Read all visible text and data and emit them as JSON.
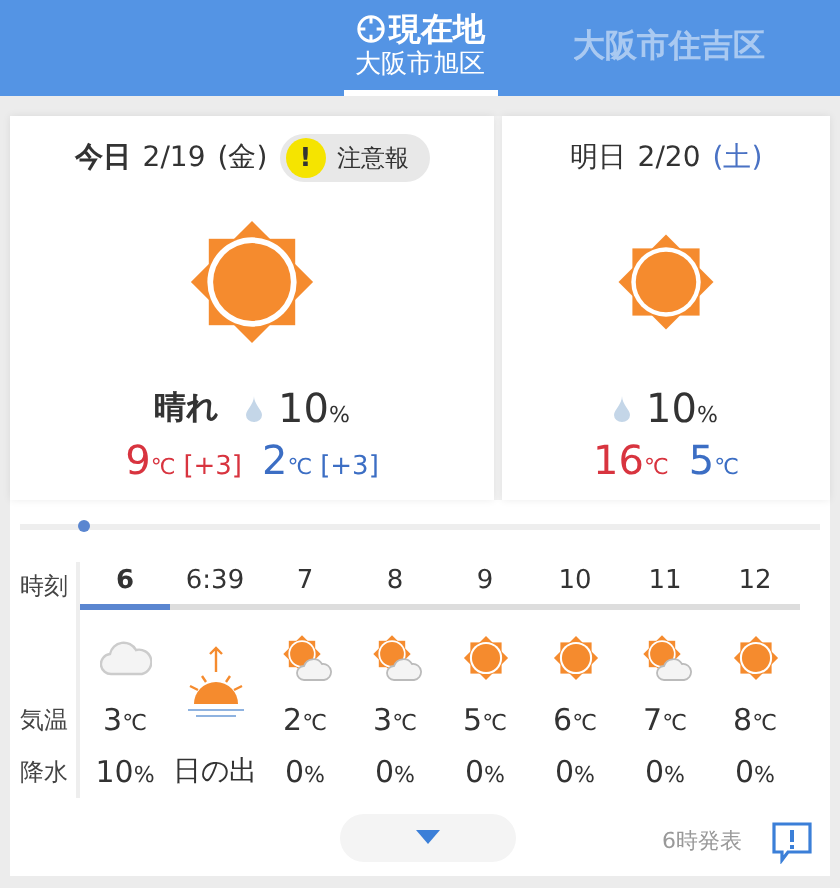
{
  "header": {
    "tabs": [
      {
        "kind": "current",
        "title": "現在地",
        "subtitle": "大阪市旭区",
        "selected": true
      },
      {
        "kind": "city",
        "title": "大阪市住吉区",
        "selected": false
      }
    ]
  },
  "days": [
    {
      "kind": "sunny",
      "label": "今日",
      "date": "2/19",
      "weekday": "(金)",
      "saturday": false,
      "alert": {
        "mark": "!",
        "label": "注意報"
      },
      "weather": "晴れ",
      "precip": {
        "value": "10",
        "unit": "%"
      },
      "high": {
        "value": "9",
        "unit": "℃",
        "diff": "[+3]"
      },
      "low": {
        "value": "2",
        "unit": "℃",
        "diff": "[+3]"
      }
    },
    {
      "kind": "sunny",
      "label": "明日",
      "date": "2/20",
      "weekday": "(土)",
      "saturday": true,
      "precip": {
        "value": "10",
        "unit": "%"
      },
      "high": {
        "value": "16",
        "unit": "℃"
      },
      "low": {
        "value": "5",
        "unit": "℃"
      }
    }
  ],
  "hourly": {
    "timeline": {
      "level": 0.08
    },
    "row_labels": [
      "時刻",
      "気温",
      "降水"
    ],
    "hours": [
      {
        "kind": "cloudy",
        "time": "6",
        "selected": true,
        "temp": {
          "value": "3",
          "unit": "℃"
        },
        "precip": {
          "value": "10",
          "unit": "%"
        }
      },
      {
        "kind": "sunrise",
        "time": "6:39",
        "selected": false,
        "label": "日の出"
      },
      {
        "kind": "partly",
        "time": "7",
        "selected": false,
        "temp": {
          "value": "2",
          "unit": "℃"
        },
        "precip": {
          "value": "0",
          "unit": "%"
        }
      },
      {
        "kind": "partly",
        "time": "8",
        "selected": false,
        "temp": {
          "value": "3",
          "unit": "℃"
        },
        "precip": {
          "value": "0",
          "unit": "%"
        }
      },
      {
        "kind": "sunny",
        "time": "9",
        "selected": false,
        "temp": {
          "value": "5",
          "unit": "℃"
        },
        "precip": {
          "value": "0",
          "unit": "%"
        }
      },
      {
        "kind": "sunny",
        "time": "10",
        "selected": false,
        "temp": {
          "value": "6",
          "unit": "℃"
        },
        "precip": {
          "value": "0",
          "unit": "%"
        }
      },
      {
        "kind": "partly",
        "time": "11",
        "selected": false,
        "temp": {
          "value": "7",
          "unit": "℃"
        },
        "precip": {
          "value": "0",
          "unit": "%"
        }
      },
      {
        "kind": "sunny",
        "time": "12",
        "selected": false,
        "temp": {
          "value": "8",
          "unit": "℃"
        },
        "precip": {
          "value": "0",
          "unit": "%"
        }
      }
    ],
    "issued": "6時発表"
  }
}
